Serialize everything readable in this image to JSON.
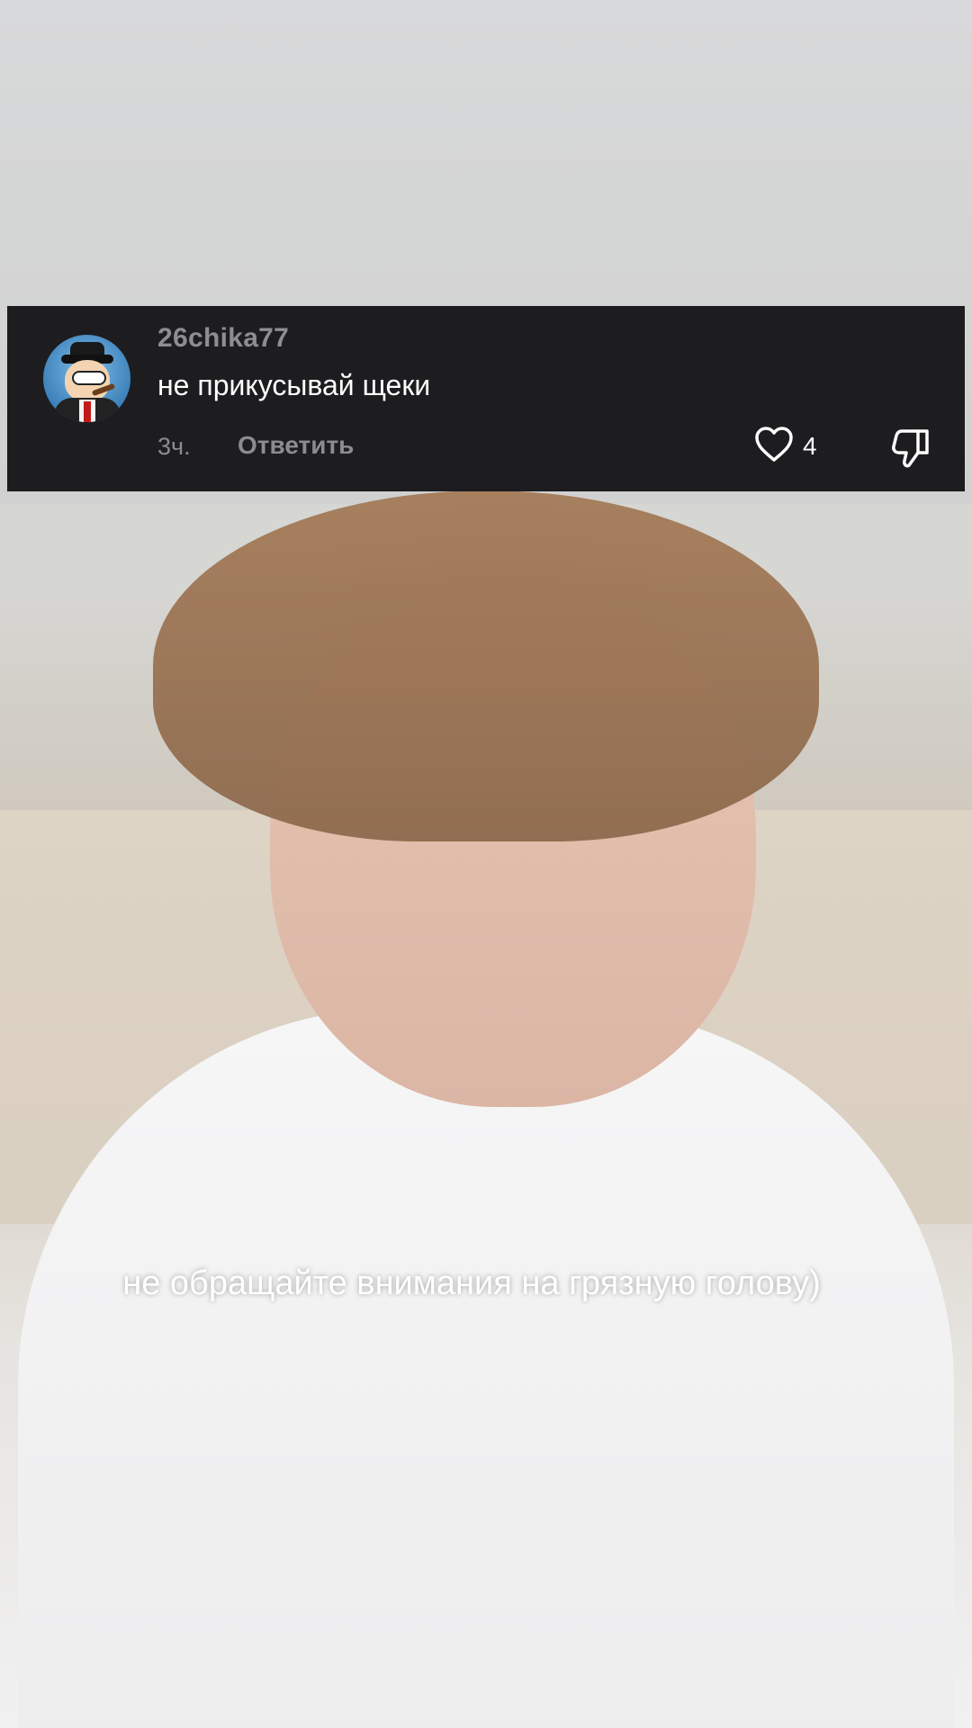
{
  "comment": {
    "username": "26chika77",
    "text": "не прикусывай щеки",
    "time": "3ч.",
    "reply_label": "Ответить",
    "like_count": "4",
    "avatar_icon": "peter-griffin-avatar",
    "like_icon": "heart-outline-icon",
    "dislike_icon": "thumbs-down-icon",
    "colors": {
      "card_bg": "#1d1d20",
      "muted_text": "#8b8b90",
      "primary_text": "#ffffff"
    }
  },
  "video": {
    "caption": "не обращайте внимания на грязную голову)"
  }
}
